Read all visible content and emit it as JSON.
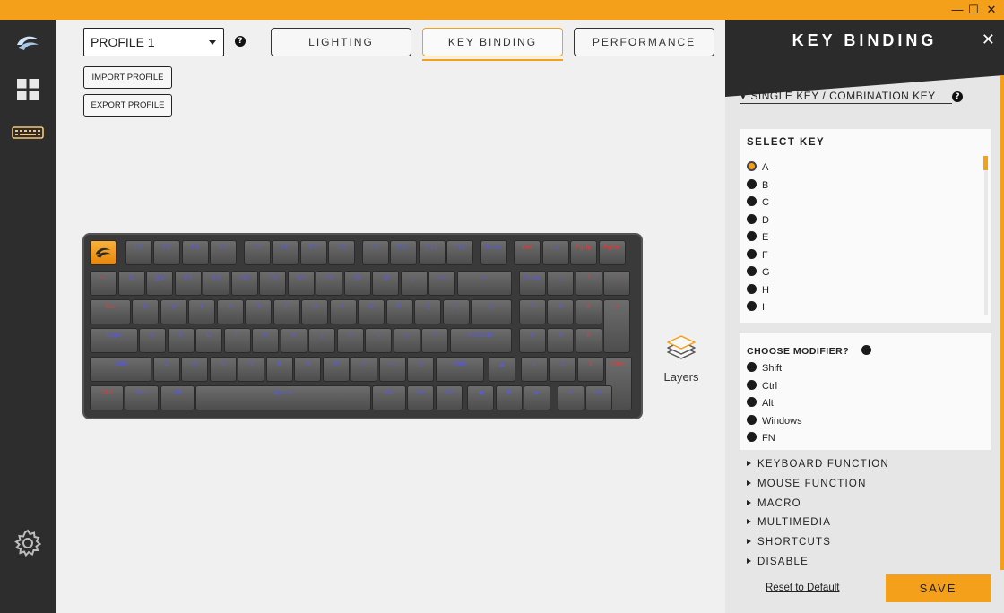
{
  "titlebar": {
    "controls": [
      "—",
      "☐",
      "✕"
    ]
  },
  "sidebar": {
    "items": [
      {
        "name": "logo-icon"
      },
      {
        "name": "dashboard-icon"
      },
      {
        "name": "keyboard-icon"
      },
      {
        "name": "settings-gear-icon"
      }
    ]
  },
  "header": {
    "profile": "PROFILE 1",
    "tabs": [
      {
        "label": "LIGHTING",
        "active": false
      },
      {
        "label": "KEY BINDING",
        "active": true
      },
      {
        "label": "PERFORMANCE",
        "active": false
      }
    ],
    "import_label": "IMPORT PROFILE",
    "export_label": "EXPORT PROFILE",
    "help": "?"
  },
  "keyboard": {
    "rows": [
      [
        "",
        "F1",
        "F2",
        "F3",
        "F4",
        "F5",
        "F6",
        "F7",
        "F8",
        "F9",
        "F10",
        "F11",
        "F12",
        "PrtSc",
        "Del",
        "Ins",
        "PgUp",
        "PgDn"
      ],
      [
        "~`",
        "!1",
        "@2",
        "#3",
        "$4",
        "%5",
        "^6",
        "&7",
        "*8",
        "(9",
        ")0",
        "_-",
        "+=",
        "←",
        "Num",
        "/",
        "*",
        "-"
      ],
      [
        "Tab",
        "Q",
        "W",
        "E",
        "R",
        "T",
        "Y",
        "U",
        "I",
        "O",
        "P",
        "{[",
        "}]",
        "|\\",
        "7",
        "8",
        "9",
        "+"
      ],
      [
        "Caps",
        "A",
        "S",
        "D",
        "F",
        "G",
        "H",
        "J",
        "K",
        "L",
        ":;",
        "\"'",
        "ASCEND",
        "4",
        "5",
        "6"
      ],
      [
        "Shift",
        "Z",
        "X",
        "C",
        "V",
        "B",
        "N",
        "M",
        "<,",
        ">.",
        "?/",
        "Shift",
        "▲",
        "1",
        "2",
        "3",
        "Enter"
      ],
      [
        "Ctrl",
        "Win",
        "Alt",
        "Space",
        "Alt",
        "Fn",
        "Ctrl",
        "◀",
        "▼",
        "▶",
        "0",
        "Del"
      ]
    ]
  },
  "layers": {
    "label": "Layers"
  },
  "panel": {
    "title": "KEY BINDING",
    "close": "✕",
    "mode": "SINGLE KEY / COMBINATION KEY",
    "help": "?",
    "select_key_title": "SELECT KEY",
    "keys": [
      "A",
      "B",
      "C",
      "D",
      "E",
      "F",
      "G",
      "H",
      "I"
    ],
    "selected_key": "A",
    "modifier_title": "CHOOSE MODIFIER?",
    "modifiers": [
      "Shift",
      "Ctrl",
      "Alt",
      "Windows",
      "FN"
    ],
    "sections": [
      "KEYBOARD FUNCTION",
      "MOUSE FUNCTION",
      "MACRO",
      "MULTIMEDIA",
      "SHORTCUTS",
      "DISABLE"
    ],
    "reset_label": "Reset to Default",
    "save_label": "SAVE"
  },
  "colors": {
    "accent": "#f5a01a",
    "sidebar": "#2d2d2d",
    "key_legend": "#5a5ad8",
    "key_legend_red": "#e03a3a"
  }
}
